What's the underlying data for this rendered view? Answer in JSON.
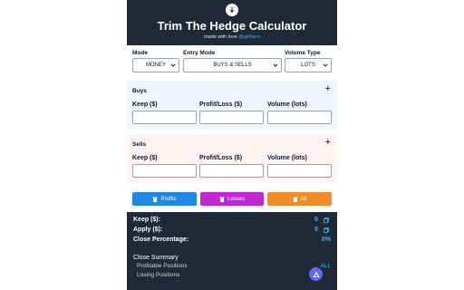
{
  "header": {
    "title": "Trim The Hedge Calculator",
    "subtitle_prefix": "made with love ",
    "subtitle_handle": "@gichero",
    "logo_icon": "down-arrow-icon"
  },
  "selectors": {
    "mode": {
      "label": "Mode",
      "value": "MONEY"
    },
    "entry_mode": {
      "label": "Entry Mode",
      "value": "BUYS & SELLS"
    },
    "volume_type": {
      "label": "Volume Type",
      "value": "LOTS"
    }
  },
  "buys": {
    "title": "Buys",
    "fields": [
      "Keep ($)",
      "Profit/Loss ($)",
      "Volume (lots)"
    ],
    "values": [
      "",
      "",
      ""
    ]
  },
  "sells": {
    "title": "Sells",
    "fields": [
      "Keep ($)",
      "Profit/Loss ($)",
      "Volume (lots)"
    ],
    "values": [
      "",
      "",
      ""
    ]
  },
  "buttons": {
    "profits": "Profits",
    "losses": "Losses",
    "all": "All",
    "icon": "trash-icon"
  },
  "summary": {
    "keep_label": "Keep ($):",
    "keep_value": "0",
    "apply_label": "Apply ($):",
    "apply_value": "0",
    "close_pct_label": "Close Percentage:",
    "close_pct_value": "0%",
    "close_summary_title": "Close Summary",
    "profitable_label": "Profitable Positions",
    "profitable_value": "ALL",
    "losing_label": "Losing Positions"
  },
  "colors": {
    "dark_bg": "#1f2937",
    "accent": "#38bdf8",
    "profits": "#1e88e5",
    "losses": "#c026d3",
    "all": "#f28c28",
    "buys_bg": "#eff4fd",
    "sells_bg": "#fdf2f2"
  }
}
